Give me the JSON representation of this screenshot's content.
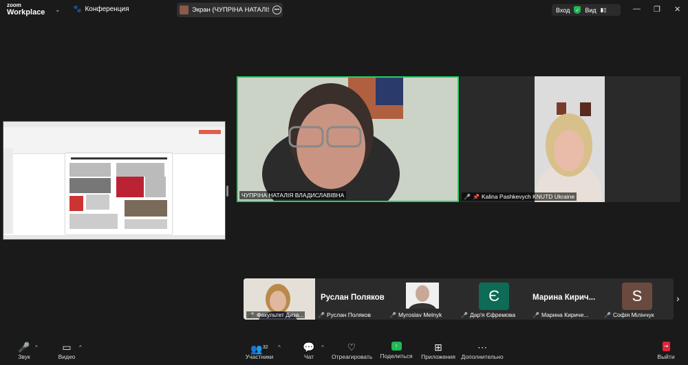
{
  "app": {
    "logo_top": "zoom",
    "logo_bottom": "Workplace"
  },
  "header": {
    "conference_label": "Конференция",
    "screen_share_label": "Экран (ЧУПРІНА НАТАЛІЯ ВЛА...",
    "entry_label": "Вход",
    "view_label": "Вид"
  },
  "speakers": [
    {
      "name": "ЧУПРІНА НАТАЛІЯ ВЛАДИСЛАВІВНА"
    },
    {
      "name": "Kalina Pashkevych KNUTD Ukraine"
    }
  ],
  "strip": {
    "tiles": [
      {
        "label": "Факультет Диза...",
        "big_name": ""
      },
      {
        "label": "Руслан Поляков",
        "big_name": "Руслан Поляков"
      },
      {
        "label": "Myroslav Melnyk",
        "big_name": ""
      },
      {
        "label": "Дар'я Єфремова",
        "big_name": "",
        "initial": "Є"
      },
      {
        "label": "Марина Кириче...",
        "big_name": "Марина  Кирич..."
      },
      {
        "label": "Софія Мілінчук",
        "big_name": "",
        "initial": "S"
      }
    ]
  },
  "toolbar": {
    "audio": "Звук",
    "video": "Видео",
    "participants": "Участники",
    "participants_count": "32",
    "chat": "Чат",
    "react": "Отреагировать",
    "share": "Поделиться",
    "apps": "Приложения",
    "more": "Дополнительно",
    "leave": "Выйти"
  },
  "colors": {
    "active_speaker": "#23d160",
    "share_green": "#1db954",
    "leave_red": "#e0243a",
    "dar_tile": "#0e6b55",
    "sofia_tile": "#6a4a3e"
  }
}
